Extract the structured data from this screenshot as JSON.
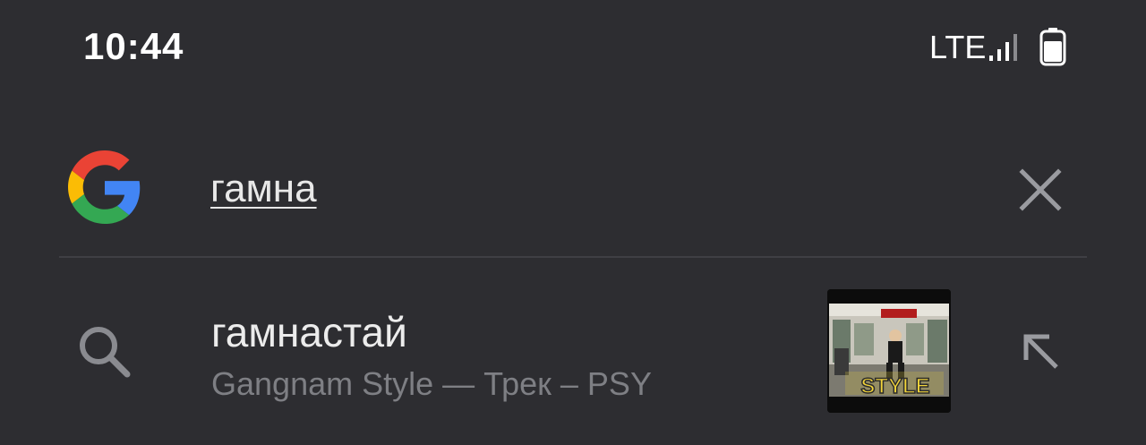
{
  "status_bar": {
    "time": "10:44",
    "network": "LTE"
  },
  "search_bar": {
    "query": "гамна",
    "logo_icon": "google-g-icon",
    "clear_icon": "close-icon"
  },
  "suggestions": [
    {
      "title": "гамнастай",
      "subtitle": "Gangnam Style — Трек – PSY",
      "thumbnail_text": "STYLE",
      "icon": "search-icon",
      "action_icon": "arrow-up-left-icon"
    }
  ],
  "colors": {
    "background": "#2d2d31",
    "text_primary": "#ececec",
    "text_secondary": "#7e7f84",
    "icon_gray": "#9a9ba0"
  }
}
